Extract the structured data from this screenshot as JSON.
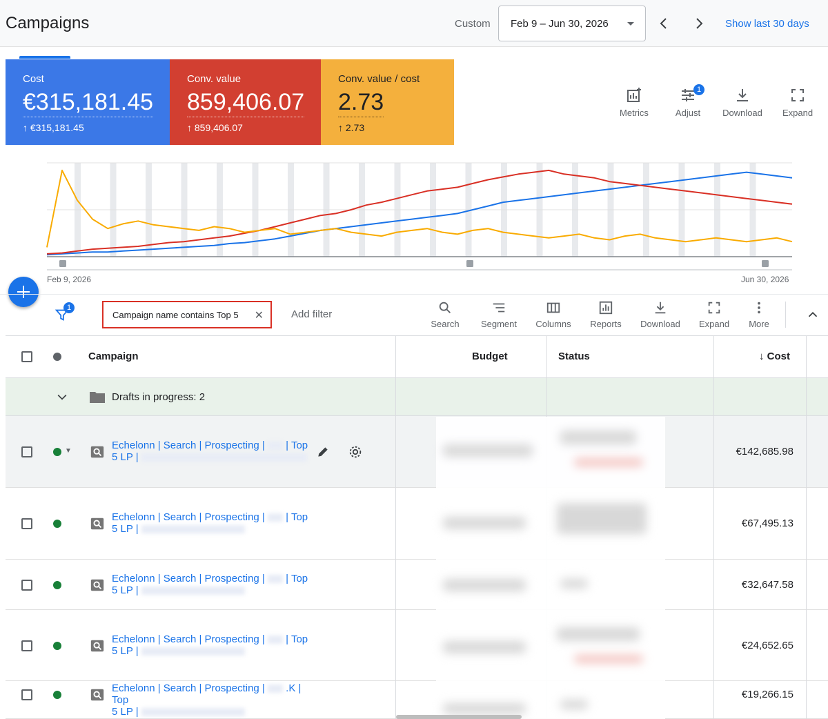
{
  "header": {
    "title": "Campaigns",
    "custom_label": "Custom",
    "date_range": "Feb 9 – Jun 30, 2026",
    "show_last": "Show last 30 days"
  },
  "metrics": [
    {
      "label": "Cost",
      "value": "€315,181.45",
      "change": "↑ €315,181.45",
      "color": "#3b78e7"
    },
    {
      "label": "Conv. value",
      "value": "859,406.07",
      "change": "↑ 859,406.07",
      "color": "#d23f31"
    },
    {
      "label": "Conv. value / cost",
      "value": "2.73",
      "change": "↑ 2.73",
      "color": "#f4b03d"
    }
  ],
  "chart_tools": {
    "metrics": "Metrics",
    "adjust": "Adjust",
    "adjust_badge": "1",
    "download": "Download",
    "expand": "Expand"
  },
  "chart": {
    "start_date": "Feb 9, 2026",
    "end_date": "Jun 30, 2026"
  },
  "chart_data": {
    "type": "line",
    "x_range": [
      "Feb 9, 2026",
      "Jun 30, 2026"
    ],
    "grid": true,
    "series": [
      {
        "color": "#1a73e8",
        "values": [
          2,
          3,
          4,
          5,
          5,
          6,
          7,
          8,
          9,
          10,
          11,
          12,
          14,
          15,
          17,
          19,
          22,
          25,
          28,
          30,
          32,
          34,
          36,
          38,
          40,
          42,
          44,
          46,
          50,
          54,
          58,
          60,
          62,
          64,
          66,
          68,
          70,
          72,
          74,
          76,
          78,
          80,
          82,
          84,
          86,
          88,
          90,
          88,
          86,
          84
        ]
      },
      {
        "color": "#d93025",
        "values": [
          3,
          4,
          6,
          8,
          9,
          10,
          11,
          13,
          15,
          16,
          18,
          20,
          22,
          25,
          28,
          32,
          36,
          40,
          44,
          46,
          50,
          55,
          58,
          62,
          66,
          70,
          72,
          74,
          78,
          82,
          85,
          88,
          90,
          92,
          88,
          86,
          84,
          80,
          78,
          76,
          74,
          72,
          70,
          68,
          66,
          64,
          62,
          60,
          58,
          56
        ]
      },
      {
        "color": "#f9ab00",
        "values": [
          10,
          92,
          60,
          40,
          30,
          35,
          38,
          34,
          32,
          30,
          28,
          32,
          30,
          26,
          28,
          30,
          24,
          26,
          28,
          30,
          26,
          24,
          22,
          26,
          28,
          30,
          26,
          24,
          28,
          30,
          26,
          24,
          22,
          20,
          22,
          24,
          20,
          18,
          22,
          24,
          20,
          18,
          16,
          18,
          20,
          18,
          16,
          18,
          20,
          16
        ]
      }
    ]
  },
  "filter": {
    "badge": "1",
    "chip": "Campaign name contains Top 5",
    "add_filter": "Add filter"
  },
  "table_tools": [
    "Search",
    "Segment",
    "Columns",
    "Reports",
    "Download",
    "Expand",
    "More"
  ],
  "table": {
    "headers": {
      "campaign": "Campaign",
      "budget": "Budget",
      "status": "Status",
      "cost": "Cost"
    },
    "drafts": "Drafts in progress: 2",
    "rows": [
      {
        "name_line1": "Echelonn | Search | Prospecting |",
        "name_top": "| Top",
        "name_line2": "5 LP |",
        "cost": "€142,685.98"
      },
      {
        "name_line1": "Echelonn | Search | Prospecting |",
        "name_top": "| Top",
        "name_line2": "5 LP |",
        "cost": "€67,495.13"
      },
      {
        "name_line1": "Echelonn | Search | Prospecting |",
        "name_top": "| Top",
        "name_line2": "5 LP |",
        "cost": "€32,647.58"
      },
      {
        "name_line1": "Echelonn | Search | Prospecting |",
        "name_top": "| Top",
        "name_line2": "5 LP |",
        "cost": "€24,652.65"
      },
      {
        "name_line1": "Echelonn | Search | Prospecting |",
        "name_top": ".K | Top",
        "name_line2": "5 LP |",
        "cost": "€19,266.15"
      }
    ]
  }
}
